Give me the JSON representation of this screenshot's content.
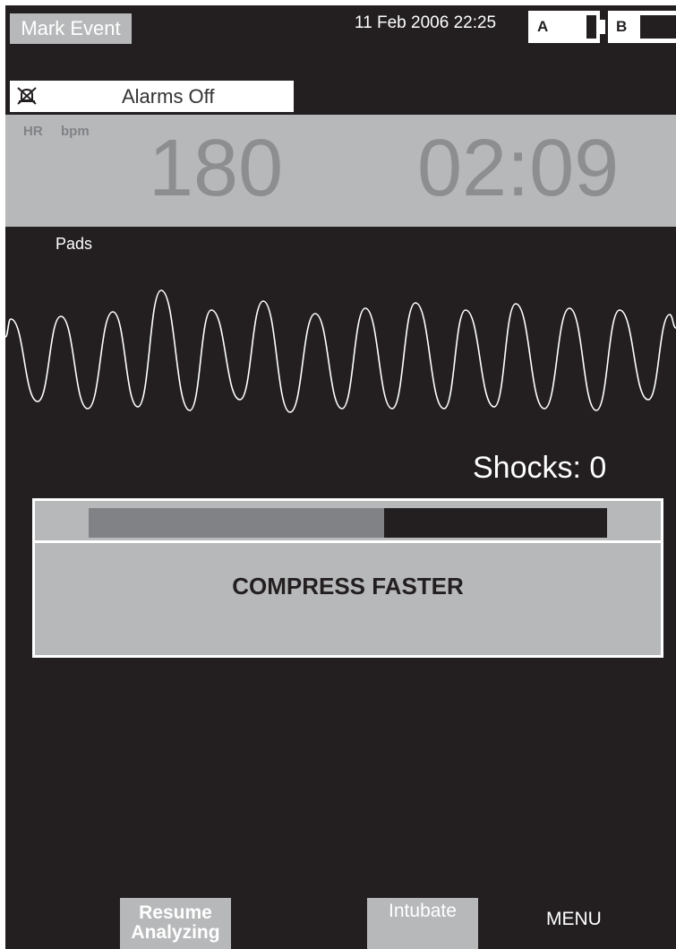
{
  "header": {
    "mark_event_label": "Mark Event",
    "datetime": "11 Feb 2006 22:25",
    "battery_a": {
      "label": "A",
      "level": 0.85
    },
    "battery_b": {
      "label": "B",
      "level": 0.0
    }
  },
  "alarms": {
    "icon": "alarm-off-icon",
    "text": "Alarms Off"
  },
  "vitals": {
    "hr_label": "HR",
    "unit_label": "bpm",
    "hr_value": "180",
    "elapsed_time": "02:09"
  },
  "waveform": {
    "lead_label": "Pads",
    "rhythm": "ventricular-fibrillation"
  },
  "shocks": {
    "text": "Shocks: 0"
  },
  "cpr_prompt": {
    "progress": 0.57,
    "message": "COMPRESS FASTER"
  },
  "softkeys": {
    "resume_line1": "Resume",
    "resume_line2": "Analyzing",
    "intubate": "Intubate",
    "menu": "MENU"
  },
  "colors": {
    "background": "#231f20",
    "panel": "#b7b8ba",
    "muted_text": "#8d8e90",
    "progress_fill": "#808285"
  }
}
